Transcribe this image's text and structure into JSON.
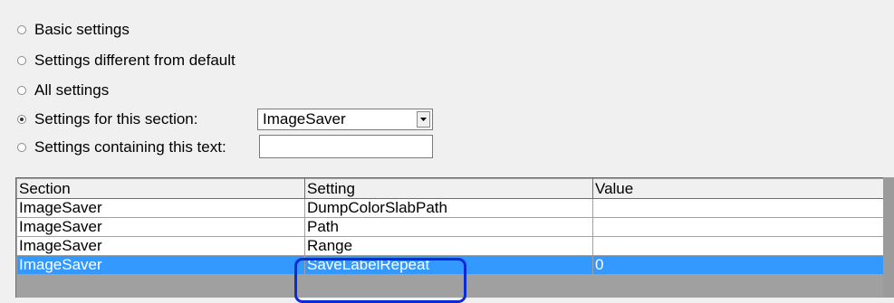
{
  "filter_options": [
    {
      "label": "Basic settings",
      "checked": false
    },
    {
      "label": "Settings different from default",
      "checked": false
    },
    {
      "label": "All settings",
      "checked": false
    },
    {
      "label": "Settings for this section:",
      "checked": true
    },
    {
      "label": "Settings containing this text:",
      "checked": false
    }
  ],
  "section_combo": {
    "value": "ImageSaver",
    "arrow_icon": "dropdown-arrow-icon"
  },
  "search_text": {
    "value": "",
    "placeholder": ""
  },
  "grid": {
    "columns": [
      "Section",
      "Setting",
      "Value"
    ],
    "rows": [
      {
        "section": "ImageSaver",
        "setting": "DumpColorSlabPath",
        "value": ""
      },
      {
        "section": "ImageSaver",
        "setting": "Path",
        "value": ""
      },
      {
        "section": "ImageSaver",
        "setting": "Range",
        "value": ""
      },
      {
        "section": "ImageSaver",
        "setting": "SaveLabelRepeat",
        "value": "0",
        "selected": true
      }
    ]
  },
  "colors": {
    "selection": "#3399ff",
    "annotation_box": "#0b2bd6",
    "background": "#f0f0f0"
  }
}
